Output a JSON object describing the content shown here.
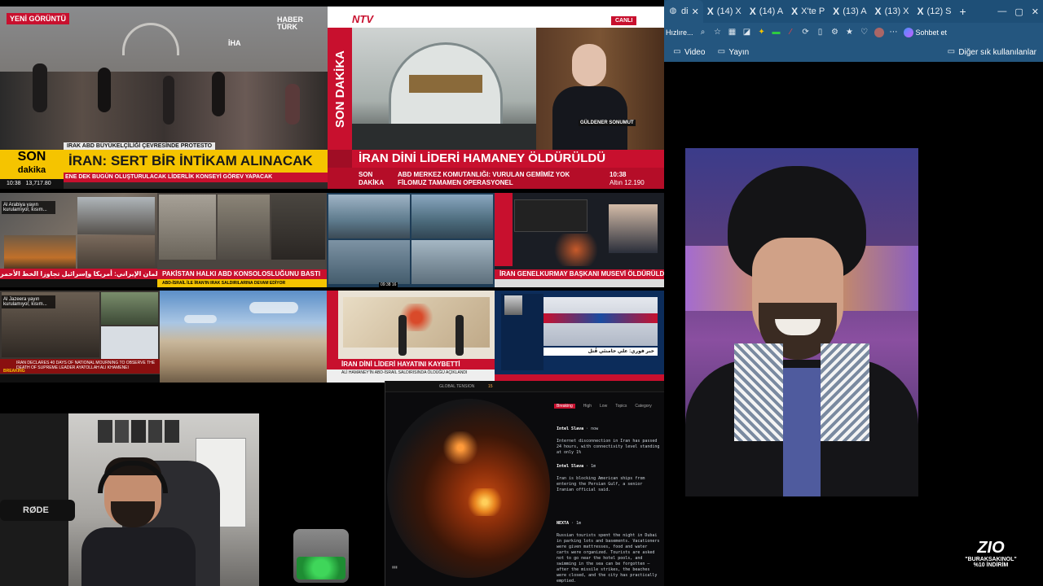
{
  "top_left": {
    "badge": "YENİ GÖRÜNTÜ",
    "channel": "HABER TÜRK",
    "live_tag": "İHA",
    "location": "IRAK ABD BÜYÜKELÇİLİĞİ ÇEVRESİNDE PROTESTO",
    "son": "SON",
    "dakika": "dakika",
    "headline": "İRAN: SERT BİR İNTİKAM ALINACAK",
    "ticker": "ENE DEK BUGÜN OLUŞTURULACAK LİDERLİK KONSEYİ GÖREV YAPACAK",
    "time": "10:38",
    "index": "13,717.80"
  },
  "top_right": {
    "channel": "NTV",
    "live": "CANLI",
    "vertical": "SON DAKİKA",
    "guest": "GÜLDENER SONUMUT",
    "headline": "İRAN DİNİ LİDERİ HAMANEY ÖLDÜRÜLDÜ",
    "son": "SON",
    "dakika": "DAKİKA",
    "ticker1": "ABD MERKEZ KOMUTANLIĞI: VURULAN GEMİMİZ YOK",
    "ticker2": "FİLOMUZ TAMAMEN OPERASYONEL",
    "time": "10:38",
    "gold": "Altın 12.190"
  },
  "grid": {
    "alarabiya_label": "Al Arabiya yayın kurulamıyor, kısım...",
    "alarabiya_ticker": "رئيس البرلمان الإيراني: أمريكا وإسرائيل تجاوزا الخط الأحمر",
    "cnn_headline": "PAKİSTAN HALKI ABD KONSOLOSLUĞUNU BASTI",
    "cnn_sub": "ABD-İSRAİL İLE İRAN'IN IRAK SALDIRILARINA DEVAM EDİYOR",
    "cam_time": "09:38 16",
    "szc_headline": "İRAN GENELKURMAY BAŞKANI MUSEVİ ÖLDÜRÜLDÜ",
    "aljazeera_label": "Al Jazeera yayın kurulamıyor, kısım...",
    "aljazeera_ticker": "IRAN DECLARES 40 DAYS OF NATIONAL MOURNING TO OBSERVE THE DEATH OF SUPREME LEADER AYATOLLAH ALI KHAMENEI",
    "aljazeera_break": "BREAKING",
    "haber_headline": "İRAN DİNİ LİDERİ HAYATINI KAYBETTİ",
    "haber_sub": "ALİ HAMANEY'İN ABD-İSRAİL SALDIRISINDA ÖLDÜĞÜ AÇIKLANDI",
    "arabic_headline": "خبر فوري: علي خامنئي قُتل"
  },
  "browser": {
    "tabs": [
      {
        "label": "di",
        "active": true
      },
      {
        "label": "(14) X"
      },
      {
        "label": "(14) A"
      },
      {
        "label": "X'te P"
      },
      {
        "label": "(13) A"
      },
      {
        "label": "(13) X"
      },
      {
        "label": "(12) S"
      }
    ],
    "address": "Hızlıre...",
    "copilot_label": "Sohbet et",
    "bookmarks": [
      "Video",
      "Yayın"
    ],
    "other_bookmarks": "Diğer sık kullanılanlar",
    "colors": {
      "tabbar": "#1e4f77",
      "toolbar": "#24567f"
    }
  },
  "map_panel": {
    "title": "GLOBAL TENSION",
    "counter": "15",
    "filters": [
      "Breaking",
      "High",
      "Low",
      "Topics",
      "Category"
    ],
    "posts": [
      {
        "author": "Intel Slava",
        "time": "now",
        "text": "Internet disconnection in Iran has passed 24 hours, with connectivity level standing at only 1%"
      },
      {
        "author": "Intel Slava",
        "time": "1m",
        "text": "Iran is blocking American ships from entering the Persian Gulf, a senior Iranian official said."
      },
      {
        "author": "NEXTA",
        "time": "1m",
        "text": "Russian tourists spent the night in Dubai in parking lots and basements. Vacationers were given mattresses, food and water carts were organized. Tourists are asked not to go near the hotel pools, and swimming in the sea can be forgotten — after the missile strikes, the beaches were closed, and the city has practically emptied."
      }
    ]
  },
  "webcam": {
    "mic_brand": "RØDE"
  },
  "promo": {
    "brand": "ZIO",
    "code": "\"BURAKSAKINOL\"",
    "discount": "%10 İNDİRİM"
  }
}
